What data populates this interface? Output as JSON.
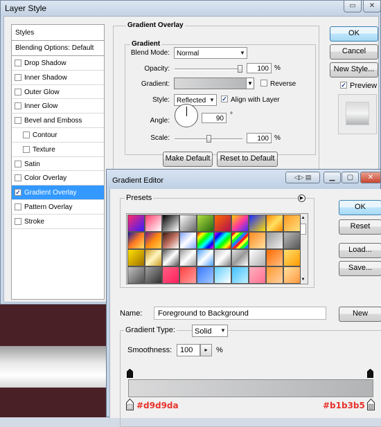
{
  "layer_style": {
    "title": "Layer Style",
    "styles_header": "Styles",
    "blending_options": "Blending Options: Default",
    "effects": [
      {
        "label": "Drop Shadow",
        "checked": false,
        "indent": false,
        "selected": false
      },
      {
        "label": "Inner Shadow",
        "checked": false,
        "indent": false,
        "selected": false
      },
      {
        "label": "Outer Glow",
        "checked": false,
        "indent": false,
        "selected": false
      },
      {
        "label": "Inner Glow",
        "checked": false,
        "indent": false,
        "selected": false
      },
      {
        "label": "Bevel and Emboss",
        "checked": false,
        "indent": false,
        "selected": false
      },
      {
        "label": "Contour",
        "checked": false,
        "indent": true,
        "selected": false
      },
      {
        "label": "Texture",
        "checked": false,
        "indent": true,
        "selected": false
      },
      {
        "label": "Satin",
        "checked": false,
        "indent": false,
        "selected": false
      },
      {
        "label": "Color Overlay",
        "checked": false,
        "indent": false,
        "selected": false
      },
      {
        "label": "Gradient Overlay",
        "checked": true,
        "indent": false,
        "selected": true
      },
      {
        "label": "Pattern Overlay",
        "checked": false,
        "indent": false,
        "selected": false
      },
      {
        "label": "Stroke",
        "checked": false,
        "indent": false,
        "selected": false
      }
    ],
    "gradient_overlay": {
      "group_title": "Gradient Overlay",
      "subgroup_title": "Gradient",
      "blend_mode_label": "Blend Mode:",
      "blend_mode_value": "Normal",
      "opacity_label": "Opacity:",
      "opacity_value": "100",
      "opacity_fraction": 1.0,
      "percent_symbol": "%",
      "gradient_label": "Gradient:",
      "reverse_label": "Reverse",
      "reverse_checked": false,
      "style_label": "Style:",
      "style_value": "Reflected",
      "align_label": "Align with Layer",
      "align_checked": true,
      "angle_label": "Angle:",
      "angle_value": "90",
      "degree_symbol": "°",
      "scale_label": "Scale:",
      "scale_value": "100",
      "scale_fraction": 0.5,
      "make_default": "Make Default",
      "reset_default": "Reset to Default"
    },
    "ok": "OK",
    "cancel": "Cancel",
    "new_style": "New Style...",
    "preview_label": "Preview",
    "preview_checked": true
  },
  "gradient_editor": {
    "title": "Gradient Editor",
    "presets_label": "Presets",
    "ok": "OK",
    "reset": "Reset",
    "load": "Load...",
    "save": "Save...",
    "name_label": "Name:",
    "name_value": "Foreground to Background",
    "new_button": "New",
    "gradient_type_label": "Gradient Type:",
    "gradient_type_value": "Solid",
    "smoothness_label": "Smoothness:",
    "smoothness_value": "100",
    "percent_symbol": "%",
    "stop_left_color": "#d9d9da",
    "stop_right_color": "#b1b3b5",
    "stop_left_label": "#d9d9da",
    "stop_right_label": "#b1b3b5",
    "preset_swatches": [
      [
        "linear-gradient(135deg,#ff2b6a,#3a1cff)",
        "linear-gradient(135deg,#ff4070,transparent)",
        "linear-gradient(135deg,#000,#fff)",
        "linear-gradient(135deg,#ffffff,#666)",
        "linear-gradient(135deg,#b0e040,#2a6a10)",
        "linear-gradient(135deg,#ff6a00,#b01050)",
        "linear-gradient(135deg,#ffd000,#ff3a9a,#3a30ff)",
        "linear-gradient(135deg,#1a2aff,#ffe000)",
        "linear-gradient(135deg,#ff8a00,#ffe060,#ff8a00)",
        "linear-gradient(135deg,#ff9a20,#ffe080)"
      ],
      [
        "linear-gradient(135deg,#1a1aa0,#ff7a20,#ffe060)",
        "linear-gradient(135deg,#7a1a8a,#ff8a10,#ffd050)",
        "linear-gradient(135deg,#3a1a10,#c07060,#fff)",
        "linear-gradient(135deg,#80a0ff,#fff,#80a0ff)",
        "linear-gradient(135deg,#ff0000,#ffff00,#00ff00,#00ffff,#0000ff,#ff00ff)",
        "linear-gradient(135deg,#ff00ff,#0000ff,#00ffff,#00ff00,#ffff00,#ff0000)",
        "repeating-linear-gradient(135deg,#ff2020 0 4px,#ffff20 4px 8px,#20ff20 8px 12px,#2080ff 12px 16px)",
        "linear-gradient(135deg,#ff8a20,#ffe0a0)",
        "linear-gradient(135deg,#9a9a9a,#eee)",
        "linear-gradient(135deg,#bbb,#555)"
      ],
      [
        "linear-gradient(135deg,#ffe000,#a07000)",
        "linear-gradient(135deg,#cc9a20,#fff6c0,#cc9a20)",
        "linear-gradient(135deg,#555,#fff,#555)",
        "linear-gradient(135deg,#9a9a9a,#fff,#9a9a9a)",
        "linear-gradient(135deg,#4aa0ff,#fff,#4aa0ff)",
        "linear-gradient(135deg,#c0c0c0,#fff,#808080)",
        "linear-gradient(135deg,#e0e0e0,#999,#fff)",
        "linear-gradient(135deg,#fff,#b0b0b0)",
        "linear-gradient(135deg,#ff6a00,#ffc080)",
        "linear-gradient(135deg,#ffe070,#ff9a00)"
      ],
      [
        "linear-gradient(135deg,#c0c0c0,#505050)",
        "linear-gradient(135deg,#a0a0a0,#303030)",
        "linear-gradient(135deg,#ff6080,#ff2060)",
        "linear-gradient(135deg,#ff4040,#ffa0a0)",
        "linear-gradient(135deg,#3a7aff,#a0c8ff)",
        "linear-gradient(135deg,#60d0ff,#fff)",
        "linear-gradient(135deg,#40c0ff,#c0f0ff)",
        "linear-gradient(135deg,#ffb0c0,#ff7090)",
        "linear-gradient(135deg,#ff9a30,#ffd0a0)",
        "linear-gradient(135deg,#ffe0a0,#ff9a40)"
      ]
    ]
  },
  "icons": {
    "minimize": "minimize-icon",
    "maximize": "maximize-icon",
    "close": "close-icon",
    "menu_arrow": "flyout-menu-icon"
  }
}
